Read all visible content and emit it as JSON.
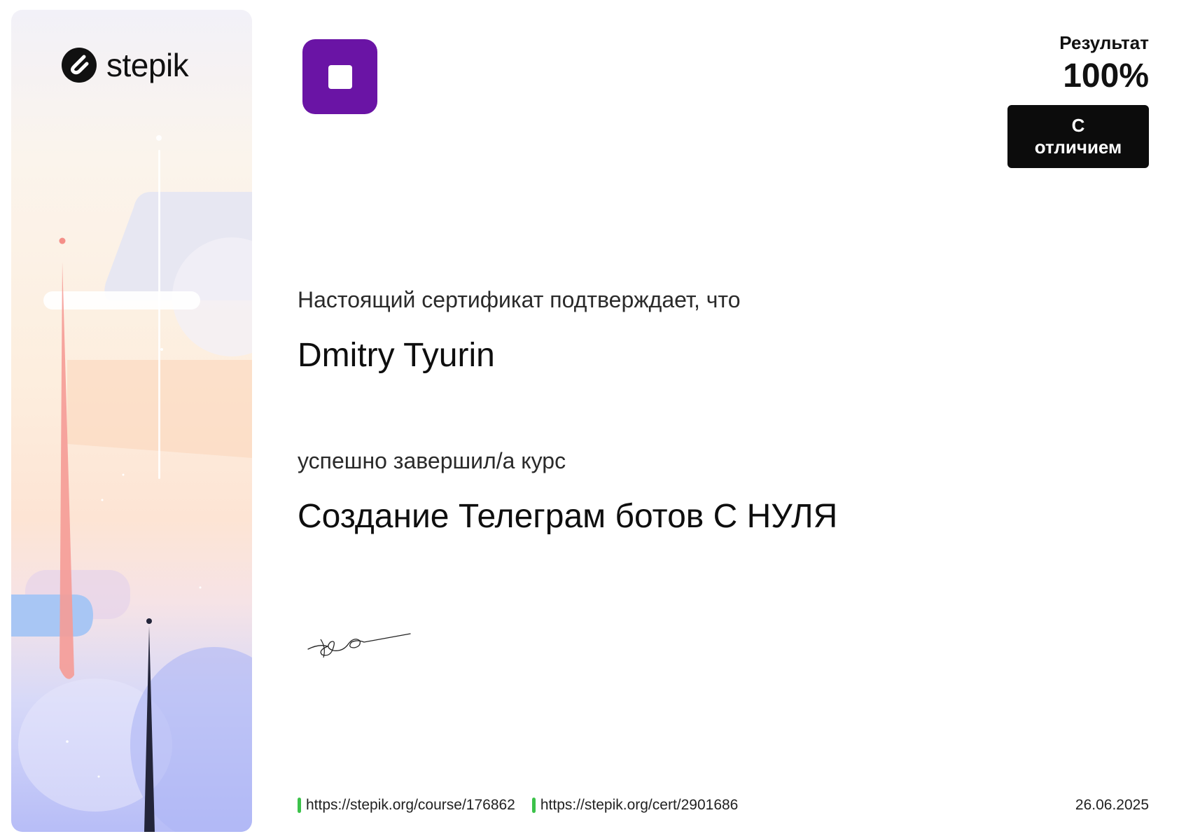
{
  "brand": {
    "name": "stepik",
    "logo_icon": "stepik-s-icon"
  },
  "badge": {
    "icon": "square-stop-icon",
    "color": "#6a14a5"
  },
  "result": {
    "label": "Результат",
    "value": "100%",
    "distinction": "С отличием"
  },
  "certificate": {
    "lead_text": "Настоящий сертификат подтверждает, что",
    "recipient_name": "Dmitry Tyurin",
    "completed_text": "успешно завершил/а  курс",
    "course_title": "Создание Телеграм ботов С НУЛЯ"
  },
  "footer": {
    "course_url": "https://stepik.org/course/176862",
    "cert_url": "https://stepik.org/cert/2901686",
    "date": "26.06.2025",
    "link_marker_color": "#3cc24a"
  }
}
